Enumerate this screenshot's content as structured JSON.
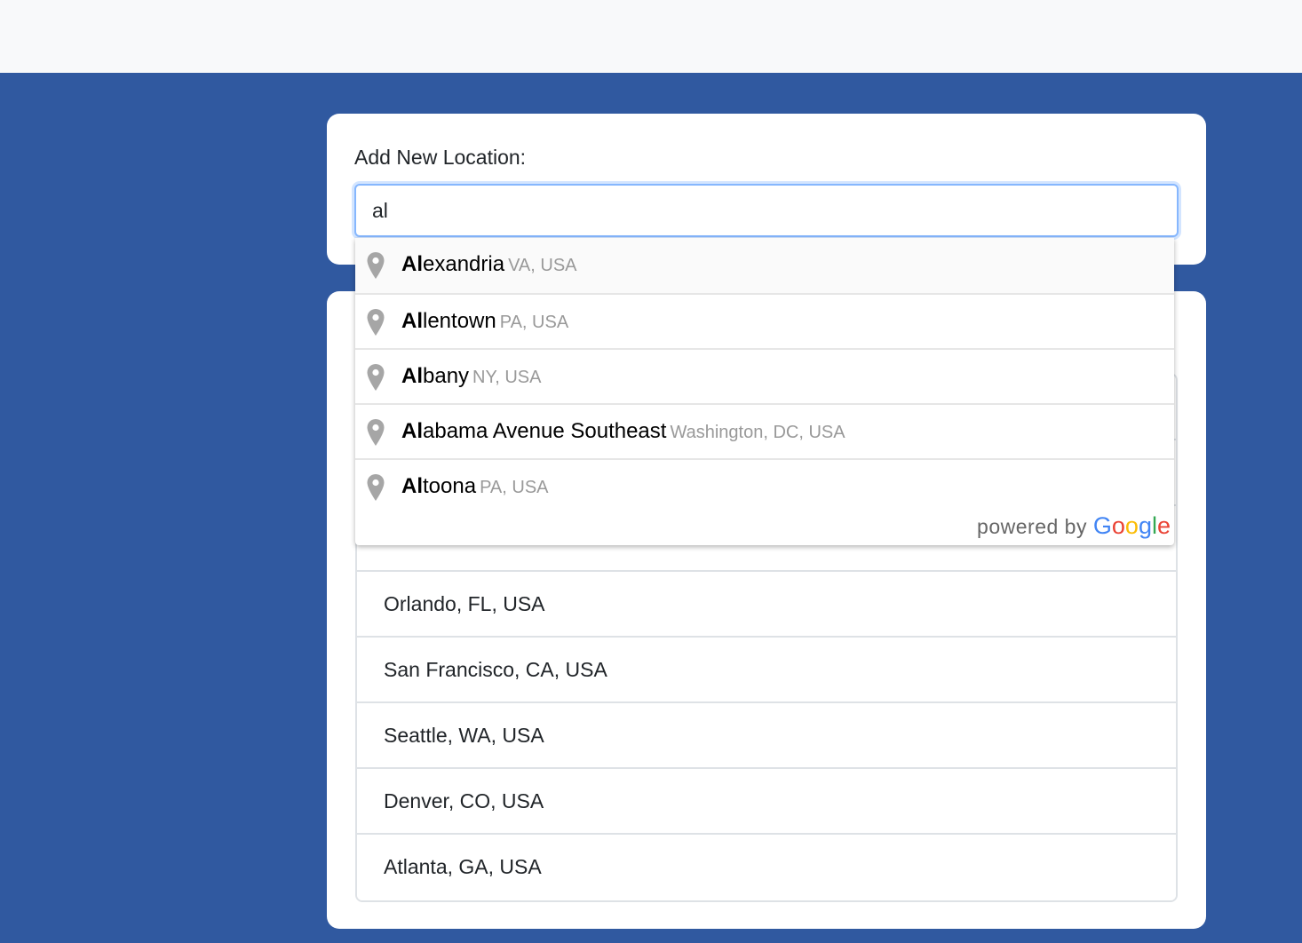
{
  "add_location": {
    "label": "Add New Location:",
    "input_value": "al"
  },
  "autocomplete": {
    "items": [
      {
        "match": "Al",
        "rest": "exandria",
        "secondary": "VA, USA"
      },
      {
        "match": "Al",
        "rest": "lentown",
        "secondary": "PA, USA"
      },
      {
        "match": "Al",
        "rest": "bany",
        "secondary": "NY, USA"
      },
      {
        "match": "Al",
        "rest": "abama Avenue Southeast",
        "secondary": "Washington, DC, USA"
      },
      {
        "match": "Al",
        "rest": "toona",
        "secondary": "PA, USA"
      }
    ],
    "powered_by": "powered by",
    "logo_letters": [
      "G",
      "o",
      "o",
      "g",
      "l",
      "e"
    ],
    "icon": "map-pin-icon",
    "pin_color": "#a6a6a6"
  },
  "locations": {
    "items": [
      {
        "name": ""
      },
      {
        "name": ""
      },
      {
        "name": ""
      },
      {
        "name": "Orlando, FL, USA"
      },
      {
        "name": "San Francisco, CA, USA"
      },
      {
        "name": "Seattle, WA, USA"
      },
      {
        "name": "Denver, CO, USA"
      },
      {
        "name": "Atlanta, GA, USA"
      }
    ]
  },
  "colors": {
    "background_blue": "#3059a0",
    "focus_border": "#86b7fe"
  }
}
